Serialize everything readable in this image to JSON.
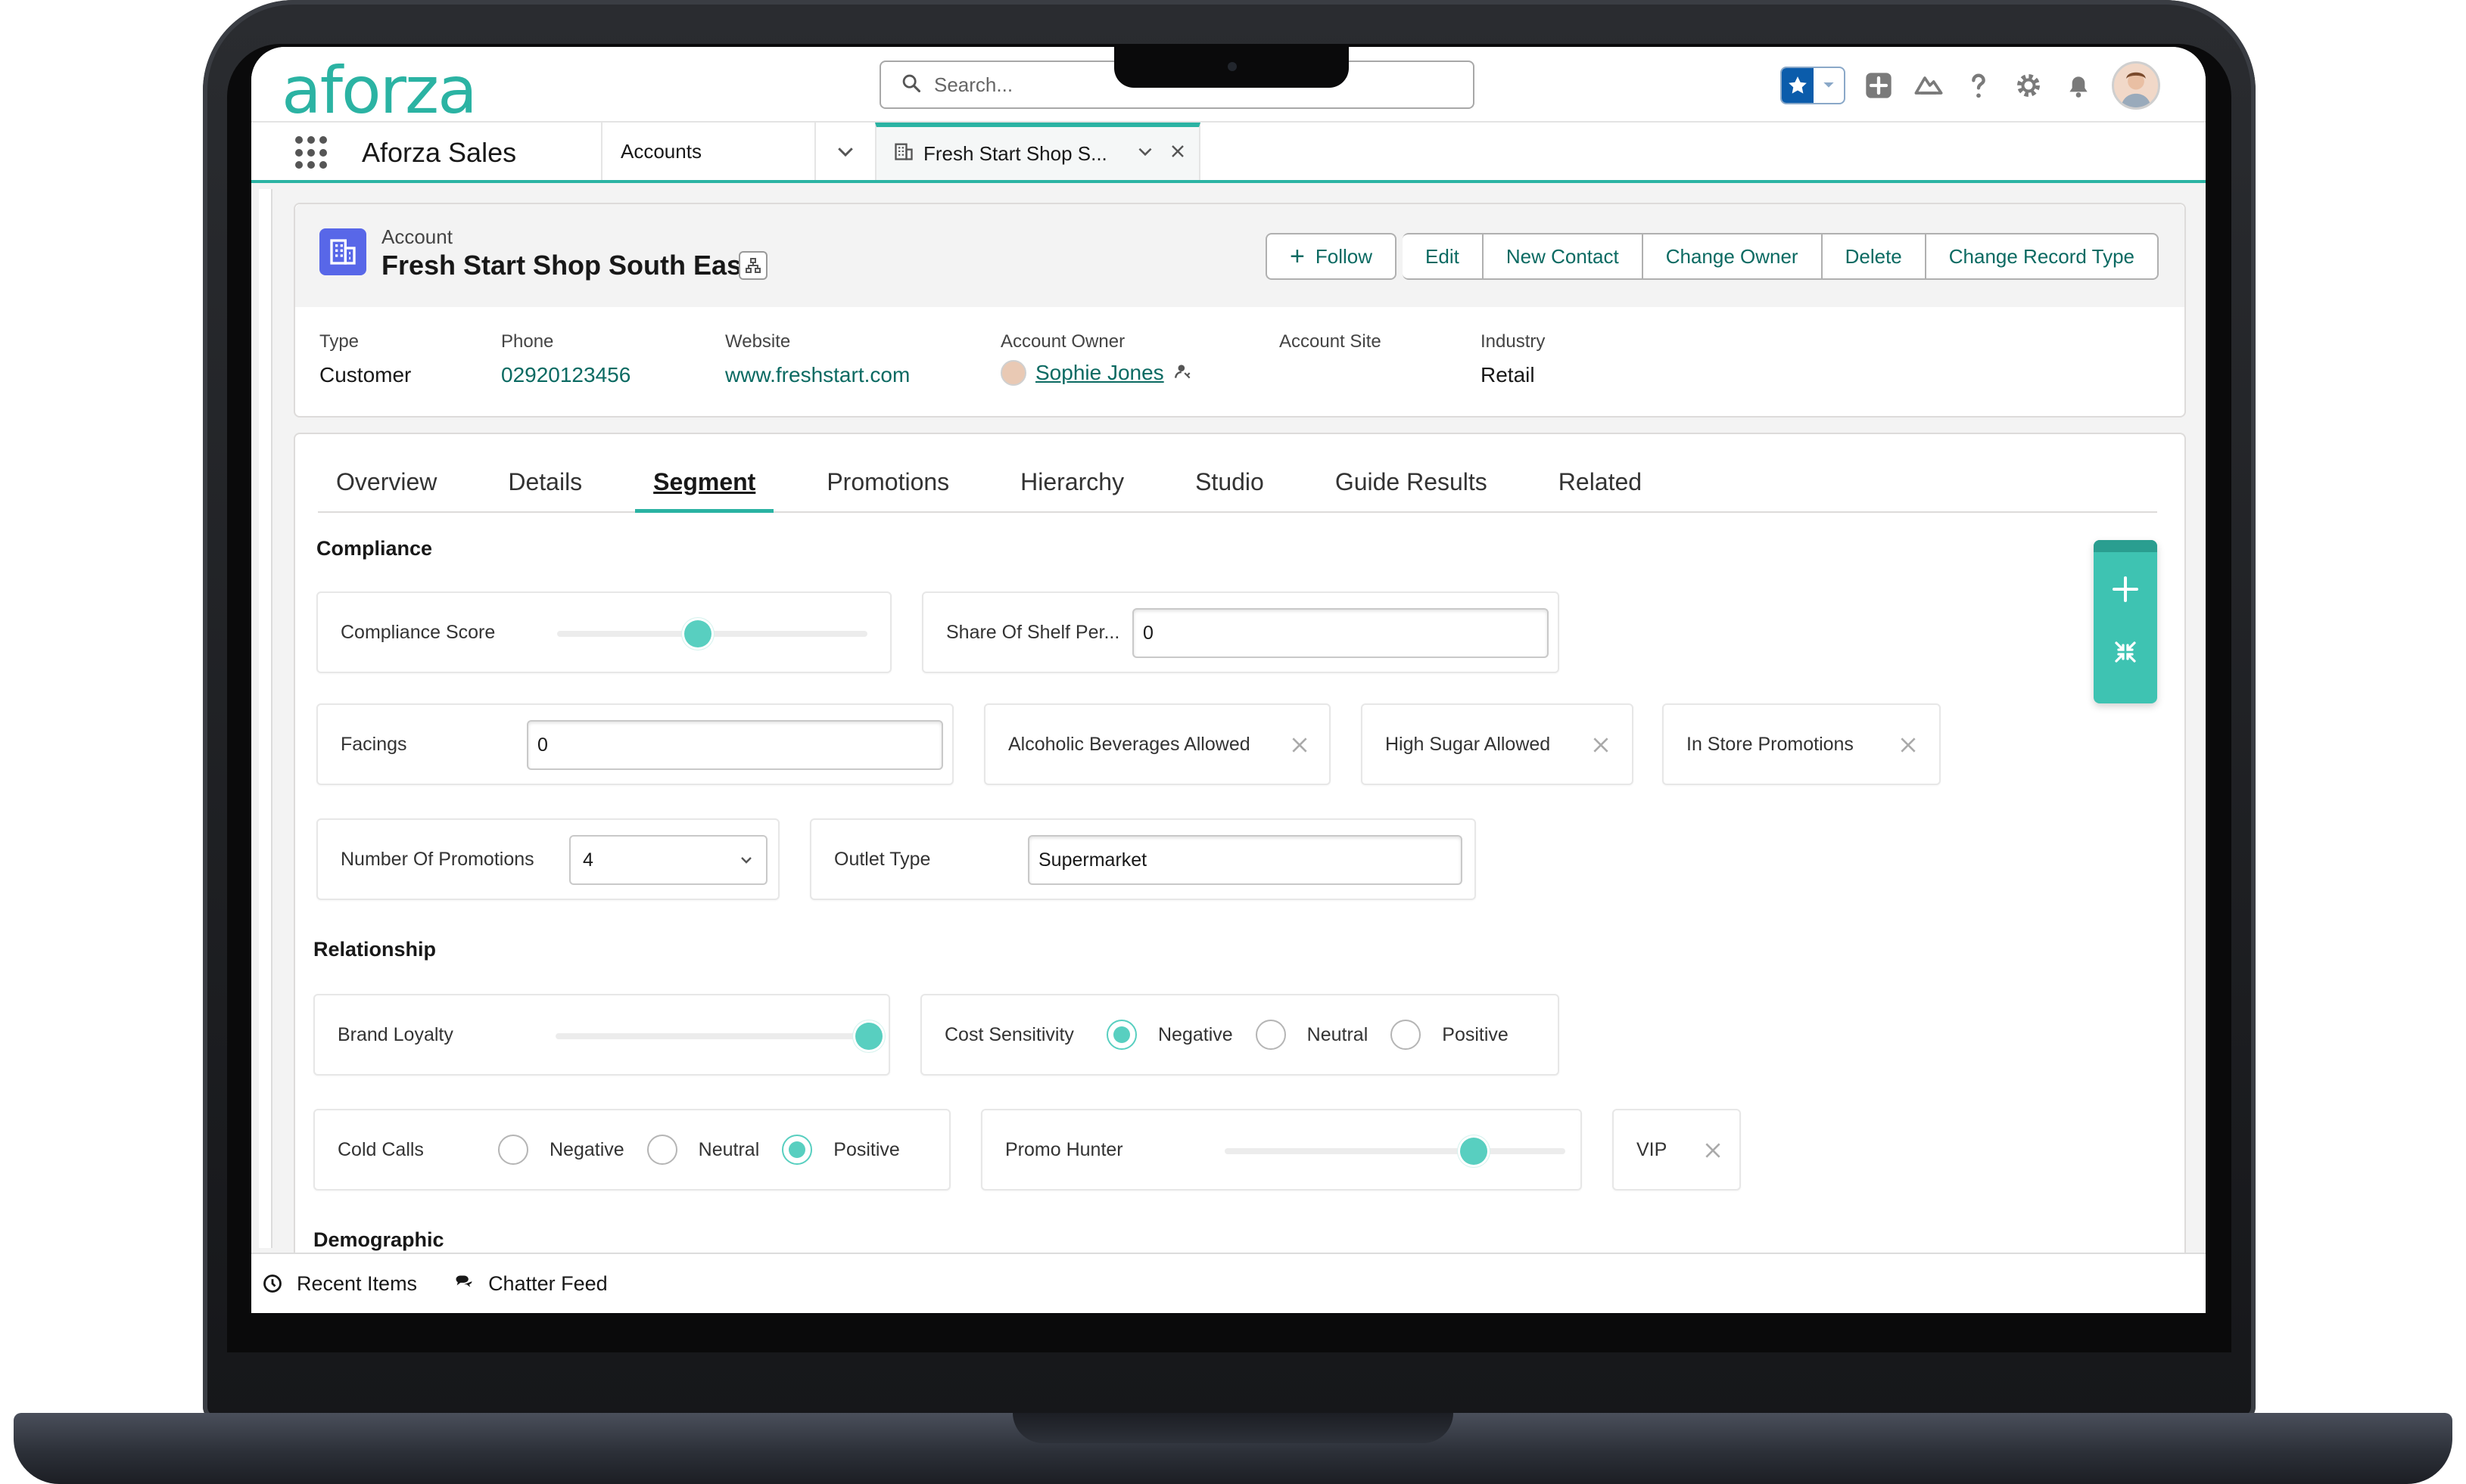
{
  "header": {
    "logo": "aforza",
    "search_placeholder": "Search..."
  },
  "app_nav": {
    "app_name": "Aforza Sales",
    "nav_item": "Accounts",
    "open_tab": "Fresh Start Shop S..."
  },
  "record": {
    "object_type": "Account",
    "name": "Fresh Start Shop South East",
    "actions": {
      "follow": "Follow",
      "edit": "Edit",
      "new_contact": "New Contact",
      "change_owner": "Change Owner",
      "delete": "Delete",
      "change_record_type": "Change Record Type"
    },
    "highlights": {
      "type_label": "Type",
      "type_value": "Customer",
      "phone_label": "Phone",
      "phone_value": "02920123456",
      "website_label": "Website",
      "website_value": "www.freshstart.com",
      "owner_label": "Account Owner",
      "owner_value": "Sophie Jones",
      "site_label": "Account Site",
      "industry_label": "Industry",
      "industry_value": "Retail"
    }
  },
  "tabs": [
    "Overview",
    "Details",
    "Segment",
    "Promotions",
    "Hierarchy",
    "Studio",
    "Guide Results",
    "Related"
  ],
  "active_tab": "Segment",
  "compliance": {
    "title": "Compliance",
    "compliance_score_label": "Compliance Score",
    "compliance_score_fraction": 0.45,
    "share_of_shelf_label": "Share Of Shelf Per...",
    "share_of_shelf_value": "0",
    "facings_label": "Facings",
    "facings_value": "0",
    "alcoholic_label": "Alcoholic Beverages Allowed",
    "high_sugar_label": "High Sugar Allowed",
    "in_store_label": "In Store Promotions",
    "num_promotions_label": "Number Of Promotions",
    "num_promotions_value": "4",
    "outlet_type_label": "Outlet Type",
    "outlet_type_value": "Supermarket"
  },
  "relationship": {
    "title": "Relationship",
    "brand_loyalty_label": "Brand Loyalty",
    "brand_loyalty_fraction": 1.0,
    "cost_sensitivity_label": "Cost Sensitivity",
    "cost_sensitivity_selected": "Negative",
    "cold_calls_label": "Cold Calls",
    "cold_calls_selected": "Positive",
    "options": {
      "negative": "Negative",
      "neutral": "Neutral",
      "positive": "Positive"
    },
    "promo_hunter_label": "Promo Hunter",
    "promo_hunter_fraction": 0.75,
    "vip_label": "VIP"
  },
  "demographic": {
    "title": "Demographic"
  },
  "utility_bar": {
    "recent_items": "Recent Items",
    "chatter_feed": "Chatter Feed"
  },
  "colors": {
    "brand_teal": "#2bb3a3",
    "slider_thumb": "#58cfc0",
    "link": "#0b6a62",
    "account_icon": "#5867e8"
  }
}
